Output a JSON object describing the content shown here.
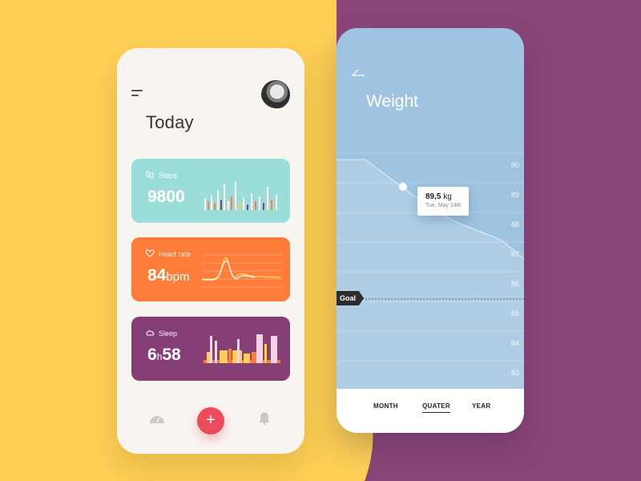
{
  "colors": {
    "background_yellow": "#fdd055",
    "background_purple": "#8b4679",
    "steps_card": "#9addd9",
    "heart_card": "#ff7d3b",
    "sleep_card": "#863e77",
    "add_button": "#eb4c5c",
    "weight_screen": "#9ec4e1"
  },
  "today_screen": {
    "title": "Today",
    "cards": {
      "steps": {
        "label": "Steps",
        "value": "9800",
        "icon": "footprints-icon"
      },
      "heart": {
        "label": "Heart rate",
        "value": "84",
        "unit": "bpm",
        "icon": "heart-icon"
      },
      "sleep": {
        "label": "Sleep",
        "hours": "6",
        "hours_unit": "h",
        "minutes": "58",
        "icon": "cloud-icon"
      }
    },
    "nav": {
      "add_label": "+",
      "icons": [
        "gauge-icon",
        "add-icon",
        "bell-icon"
      ]
    }
  },
  "weight_screen": {
    "title": "Weight",
    "y_ticks": [
      "90",
      "89",
      "88",
      "87",
      "86",
      "85",
      "84",
      "83"
    ],
    "goal_label": "Goal",
    "tooltip": {
      "value": "89,5",
      "unit": "kg",
      "date": "Tue, May 14th"
    },
    "period_tabs": [
      {
        "label": "MONTH",
        "active": false
      },
      {
        "label": "QUATER",
        "active": true
      },
      {
        "label": "YEAR",
        "active": false
      }
    ]
  }
}
